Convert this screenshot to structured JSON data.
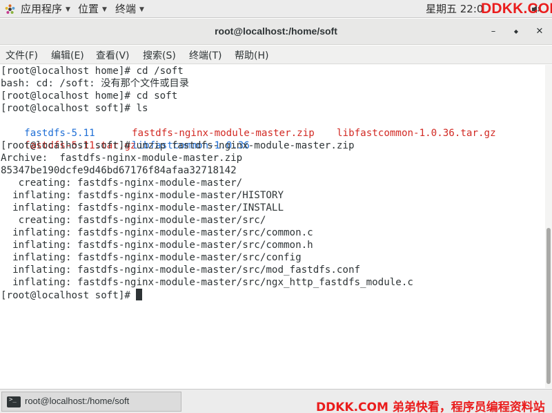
{
  "top_panel": {
    "applications": "应用程序",
    "places": "位置",
    "terminal": "终端",
    "clock": "星期五 22:0",
    "watermark": "DDKK.COM"
  },
  "window": {
    "title": "root@localhost:/home/soft",
    "buttons": {
      "minimize": "–",
      "maximize": "◆",
      "close": "✕"
    }
  },
  "menubar": {
    "file": "文件(F)",
    "edit": "编辑(E)",
    "view": "查看(V)",
    "search": "搜索(S)",
    "terminal": "终端(T)",
    "help": "帮助(H)"
  },
  "terminal": {
    "lines": [
      "[root@localhost home]# cd /soft",
      "bash: cd: /soft: 没有那个文件或目录",
      "[root@localhost home]# cd soft",
      "[root@localhost soft]# ls",
      {
        "a": "fastdfs-5.11",
        "b": "fastdfs-nginx-module-master.zip",
        "c": "libfastcommon-1.0.36.tar.gz"
      },
      {
        "a": "fastdfs-5.11.tar.gz",
        "b": "libfastcommon-1.0.36"
      },
      "[root@localhost soft]# unzip fastdfs-nginx-module-master.zip",
      "Archive:  fastdfs-nginx-module-master.zip",
      "85347be190dcfe9d46bd67176f84afaa32718142",
      "   creating: fastdfs-nginx-module-master/",
      "  inflating: fastdfs-nginx-module-master/HISTORY",
      "  inflating: fastdfs-nginx-module-master/INSTALL",
      "   creating: fastdfs-nginx-module-master/src/",
      "  inflating: fastdfs-nginx-module-master/src/common.c",
      "  inflating: fastdfs-nginx-module-master/src/common.h",
      "  inflating: fastdfs-nginx-module-master/src/config",
      "  inflating: fastdfs-nginx-module-master/src/mod_fastdfs.conf",
      "  inflating: fastdfs-nginx-module-master/src/ngx_http_fastdfs_module.c",
      "[root@localhost soft]# "
    ],
    "colors": {
      "directory": "#1f6fd6",
      "archive": "#d22a24",
      "text": "#2e3436"
    }
  },
  "taskbar": {
    "item_label": "root@localhost:/home/soft",
    "watermark": "DDKK.COM 弟弟快看，程序员编程资料站"
  }
}
